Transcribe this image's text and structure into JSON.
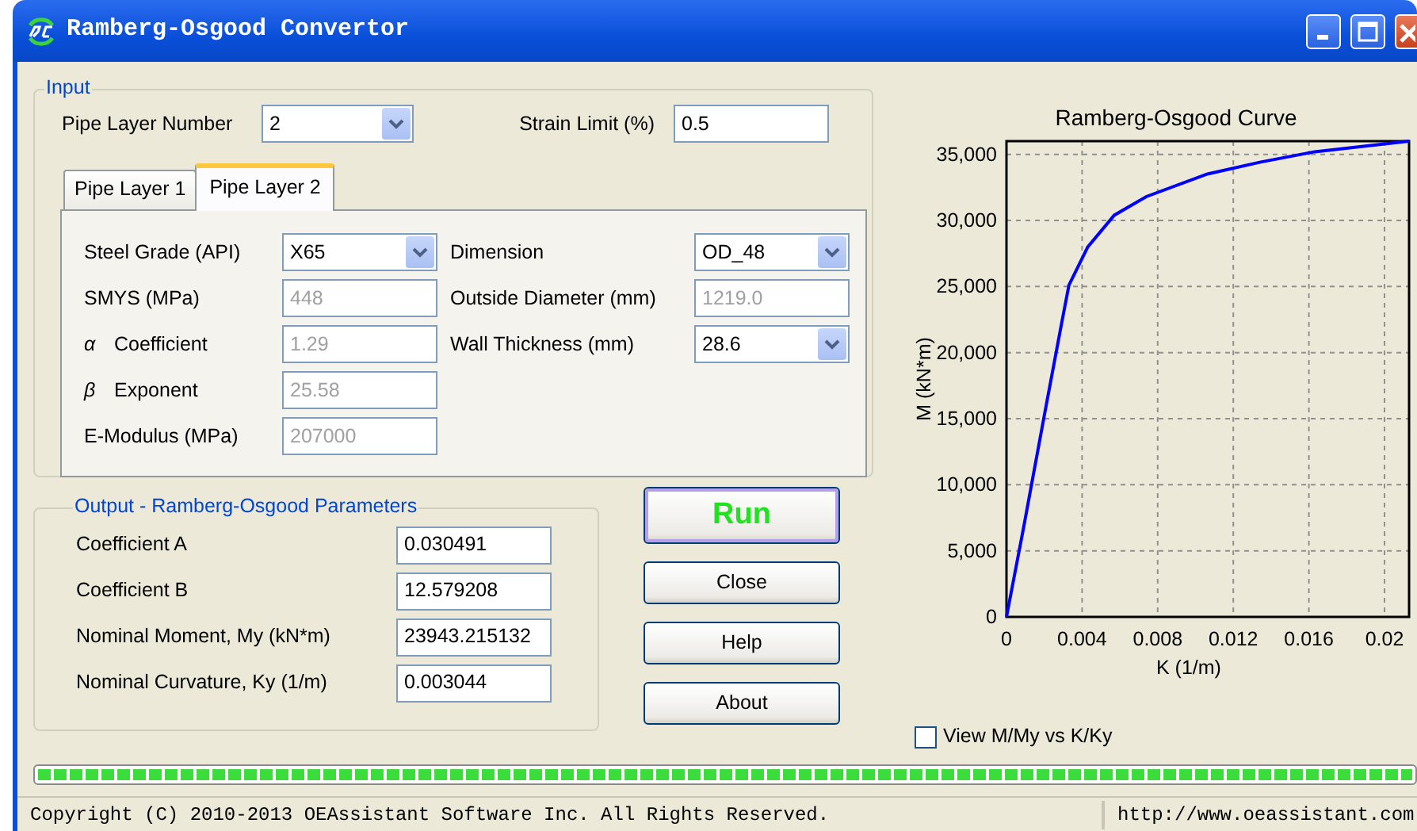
{
  "window": {
    "title": "Ramberg-Osgood Convertor"
  },
  "input": {
    "legend": "Input",
    "layer_number": {
      "label": "Pipe Layer Number",
      "value": "2"
    },
    "strain_limit": {
      "label": "Strain Limit (%)",
      "value": "0.5"
    },
    "tabs": [
      {
        "label": "Pipe Layer 1",
        "selected": false
      },
      {
        "label": "Pipe Layer 2",
        "selected": true
      }
    ],
    "left_fields": [
      {
        "label": "Steel Grade (API)",
        "value": "X65",
        "kind": "combo",
        "disabled": false
      },
      {
        "label": "SMYS (MPa)",
        "value": "448",
        "kind": "text",
        "disabled": true
      },
      {
        "symbol": "α",
        "label": "Coefficient",
        "value": "1.29",
        "kind": "text",
        "disabled": true
      },
      {
        "symbol": "β",
        "label": "Exponent",
        "value": "25.58",
        "kind": "text",
        "disabled": true
      },
      {
        "label": "E-Modulus (MPa)",
        "value": "207000",
        "kind": "text",
        "disabled": true
      }
    ],
    "right_fields": [
      {
        "label": "Dimension",
        "value": "OD_48",
        "kind": "combo",
        "disabled": false
      },
      {
        "label": "Outside Diameter (mm)",
        "value": "1219.0",
        "kind": "text",
        "disabled": true
      },
      {
        "label": "Wall Thickness (mm)",
        "value": "28.6",
        "kind": "combo",
        "disabled": false
      }
    ]
  },
  "output": {
    "legend": "Output - Ramberg-Osgood Parameters",
    "fields": [
      {
        "label": "Coefficient A",
        "value": "0.030491"
      },
      {
        "label": "Coefficient B",
        "value": "12.579208"
      },
      {
        "label": "Nominal Moment, My (kN*m)",
        "value": "23943.215132"
      },
      {
        "label": "Nominal Curvature, Ky (1/m)",
        "value": "0.003044"
      }
    ]
  },
  "buttons": [
    {
      "label": "Run",
      "kind": "primary"
    },
    {
      "label": "Close",
      "kind": "normal"
    },
    {
      "label": "Help",
      "kind": "normal"
    },
    {
      "label": "About",
      "kind": "normal"
    }
  ],
  "chart": {
    "chart_data": {
      "type": "line",
      "title": "Ramberg-Osgood Curve",
      "xlabel": "K (1/m)",
      "ylabel": "M (kN*m)",
      "xlim": [
        0,
        0.0213
      ],
      "ylim": [
        0,
        36000
      ],
      "xticks": [
        {
          "value": 0,
          "label": "0"
        },
        {
          "value": 0.004,
          "label": "0.004"
        },
        {
          "value": 0.008,
          "label": "0.008"
        },
        {
          "value": 0.012,
          "label": "0.012"
        },
        {
          "value": 0.016,
          "label": "0.016"
        },
        {
          "value": 0.02,
          "label": "0.02"
        }
      ],
      "yticks": [
        {
          "value": 0,
          "label": "0"
        },
        {
          "value": 5000,
          "label": "5,000"
        },
        {
          "value": 10000,
          "label": "10,000"
        },
        {
          "value": 15000,
          "label": "15,000"
        },
        {
          "value": 20000,
          "label": "20,000"
        },
        {
          "value": 25000,
          "label": "25,000"
        },
        {
          "value": 30000,
          "label": "30,000"
        },
        {
          "value": 35000,
          "label": "35,000"
        }
      ],
      "x": [
        0,
        0.0009,
        0.002,
        0.0029,
        0.0033,
        0.0043,
        0.0057,
        0.0074,
        0.0106,
        0.0134,
        0.0163,
        0.0213
      ],
      "grid": true,
      "series": [
        {
          "color": "#0000ff",
          "values": [
            0,
            6700,
            15200,
            22100,
            25100,
            28000,
            30400,
            31800,
            33500,
            34400,
            35200,
            36000
          ]
        }
      ]
    }
  },
  "view_checkbox": {
    "label": "View M/My vs K/Ky",
    "checked": false
  },
  "progress": {
    "level": 1
  },
  "status_bar": [
    "Copyright (C) 2010-2013 OEAssistant Software Inc. All Rights Reserved.",
    "http://www.oeassistant.com"
  ]
}
